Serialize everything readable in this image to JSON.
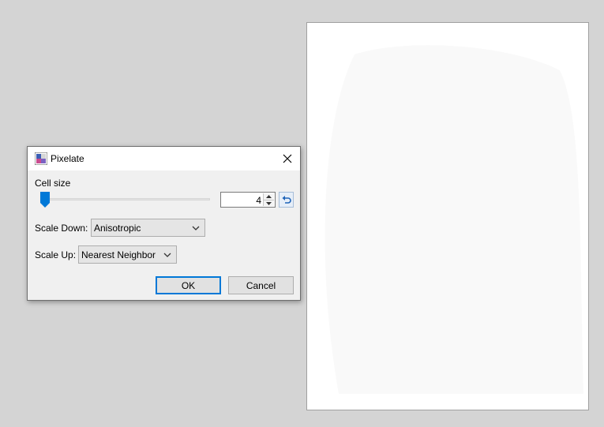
{
  "dialog": {
    "title": "Pixelate",
    "cell_size_label": "Cell size",
    "cell_size_value": "4",
    "scale_down_label": "Scale Down:",
    "scale_down_value": "Anisotropic",
    "scale_up_label": "Scale Up:",
    "scale_up_value": "Nearest Neighbor",
    "ok_label": "OK",
    "cancel_label": "Cancel"
  },
  "colors": {
    "accent": "#0078d7",
    "background": "#d4d4d4",
    "dialog_bg": "#f0f0f0",
    "flame_red": "#e8351d",
    "flame_orange": "#f7891d",
    "flame_yellow": "#fde23a"
  },
  "icons": {
    "app": "pixelate-icon",
    "close": "close-icon",
    "reset": "reset-icon",
    "dropdown": "chevron-down-icon"
  }
}
